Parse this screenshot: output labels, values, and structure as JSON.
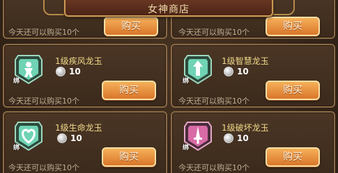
{
  "shop": {
    "title": "女神商店",
    "buy_label": "购买"
  },
  "top_row": [
    {
      "limit_text": "今天还可以购买10个"
    },
    {
      "limit_text": "今天还可以购买10个"
    }
  ],
  "items": [
    {
      "name": "1级疾风龙玉",
      "price": "10",
      "bind": "绑",
      "limit_text": "今天还可以购买10个",
      "gem_color": "#6fd3b4",
      "symbol": "figure-icon"
    },
    {
      "name": "1级智慧龙玉",
      "price": "10",
      "bind": "绑",
      "limit_text": "今天还可以购买10个",
      "gem_color": "#6fd3b4",
      "symbol": "arrow-icon"
    },
    {
      "name": "1级生命龙玉",
      "price": "10",
      "bind": "绑",
      "limit_text": "今天还可以购买10个",
      "gem_color": "#6fd3b4",
      "symbol": "heart-icon"
    },
    {
      "name": "1级破坏龙玉",
      "price": "10",
      "bind": "绑",
      "limit_text": "今天还可以购买10个",
      "gem_color": "#d86aa6",
      "symbol": "sword-icon"
    }
  ]
}
